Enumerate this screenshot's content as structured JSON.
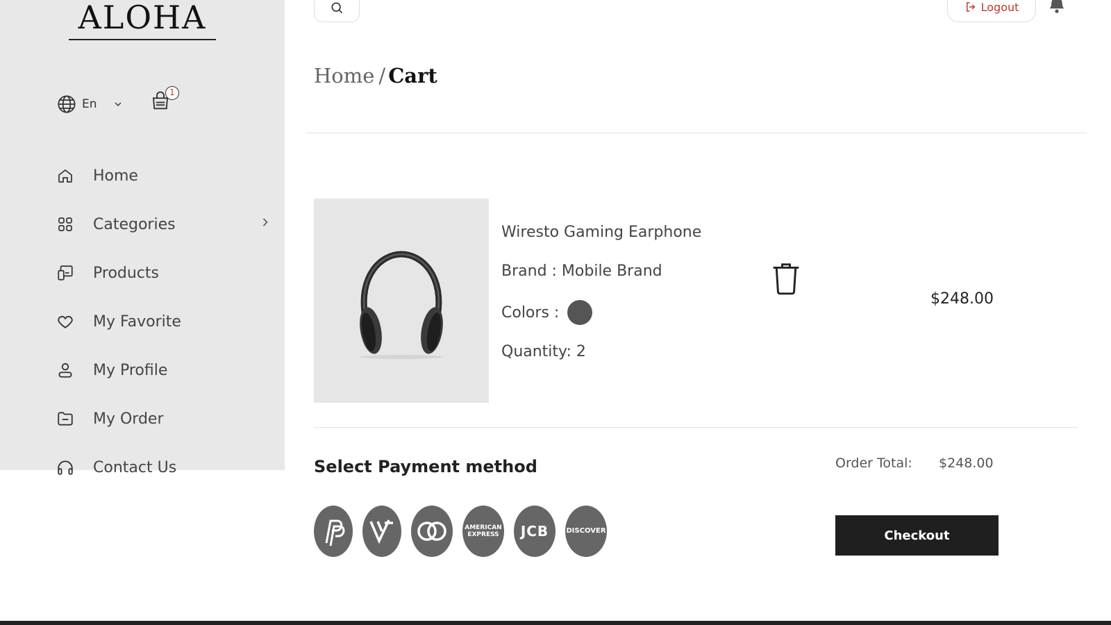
{
  "brand": {
    "logo": "ALOHA"
  },
  "header": {
    "language": "En",
    "cart_count": "1",
    "logout_label": "Logout"
  },
  "sidebar": {
    "items": [
      {
        "label": "Home",
        "icon": "home-icon"
      },
      {
        "label": "Categories",
        "icon": "grid-icon"
      },
      {
        "label": "Products",
        "icon": "devices-icon"
      },
      {
        "label": "My Favorite",
        "icon": "heart-icon"
      },
      {
        "label": "My Profile",
        "icon": "user-icon"
      },
      {
        "label": "My Order",
        "icon": "folder-icon"
      },
      {
        "label": "Contact Us",
        "icon": "headphones-icon"
      }
    ]
  },
  "breadcrumb": {
    "home": "Home",
    "separator": "/",
    "current": "Cart"
  },
  "cart_item": {
    "name": "Wiresto Gaming Earphone",
    "brand_line": "Brand : Mobile Brand",
    "colors_label": "Colors :",
    "color_swatch": "#555555",
    "quantity_line": "Quantity: 2",
    "price": "$248.00"
  },
  "payment": {
    "title": "Select Payment method",
    "methods": [
      {
        "name": "paypal",
        "mark": "P"
      },
      {
        "name": "visa",
        "mark": "V"
      },
      {
        "name": "mastercard",
        "mark": ""
      },
      {
        "name": "amex",
        "mark": "AMERICAN EXPRESS"
      },
      {
        "name": "jcb",
        "mark": "JCB"
      },
      {
        "name": "discover",
        "mark": "DISCOVER"
      }
    ]
  },
  "order": {
    "total_label": "Order Total:",
    "total_value": "$248.00",
    "checkout_label": "Checkout"
  },
  "colors": {
    "accent": "#1f1f1f",
    "sidebar_bg": "#e8e8e8",
    "logout": "#c0392b"
  }
}
